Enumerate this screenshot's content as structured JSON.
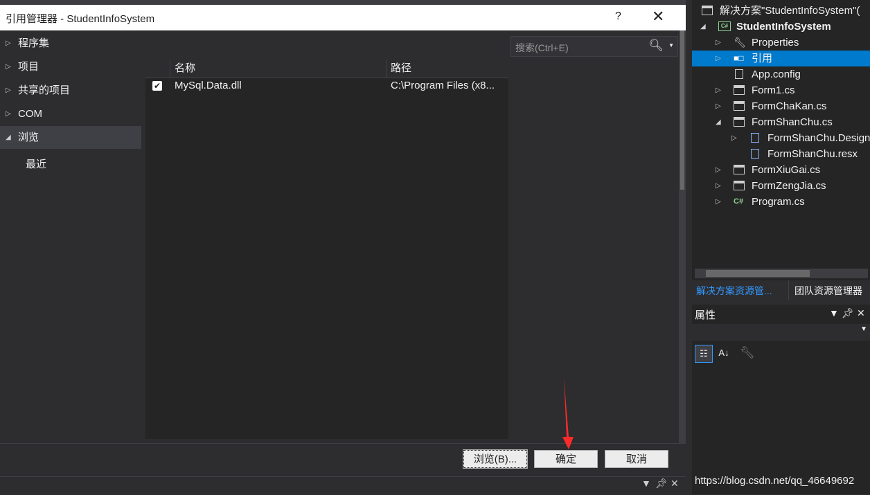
{
  "dialog": {
    "title": "引用管理器 - StudentInfoSystem",
    "help_label": "?",
    "close_label": "✕",
    "nav_items": [
      {
        "label": "程序集",
        "arrow": "▷"
      },
      {
        "label": "项目",
        "arrow": "▷"
      },
      {
        "label": "共享的项目",
        "arrow": "▷"
      },
      {
        "label": "COM",
        "arrow": "▷"
      },
      {
        "label": "浏览",
        "arrow": "◢",
        "selected": true
      },
      {
        "label": "最近",
        "arrow": ""
      }
    ],
    "search": {
      "placeholder": "搜索(Ctrl+E)",
      "icon": "search-icon"
    },
    "grid": {
      "columns": [
        "名称",
        "路径"
      ],
      "rows": [
        {
          "checked": true,
          "name": "MySql.Data.dll",
          "path": "C:\\Program Files (x8..."
        }
      ]
    },
    "buttons": {
      "browse": "浏览(B)...",
      "ok": "确定",
      "cancel": "取消"
    },
    "annotation_color": "#ff2a2a"
  },
  "solution_explorer": {
    "items": [
      {
        "label": "解决方案\"StudentInfoSystem\"(",
        "icon": "solution-icon",
        "tri": ""
      },
      {
        "label": "StudentInfoSystem",
        "icon": "csharp-project-icon",
        "tri": "◢",
        "bold": true
      },
      {
        "label": "Properties",
        "icon": "wrench-icon",
        "tri": "▷"
      },
      {
        "label": "引用",
        "icon": "references-icon",
        "tri": "▷",
        "selected": true
      },
      {
        "label": "App.config",
        "icon": "config-file-icon",
        "tri": ""
      },
      {
        "label": "Form1.cs",
        "icon": "form-icon",
        "tri": "▷"
      },
      {
        "label": "FormChaKan.cs",
        "icon": "form-icon",
        "tri": "▷"
      },
      {
        "label": "FormShanChu.cs",
        "icon": "form-icon",
        "tri": "◢"
      },
      {
        "label": "FormShanChu.Designer.cs",
        "icon": "designer-file-icon",
        "tri": "▷"
      },
      {
        "label": "FormShanChu.resx",
        "icon": "resx-file-icon",
        "tri": ""
      },
      {
        "label": "FormXiuGai.cs",
        "icon": "form-icon",
        "tri": "▷"
      },
      {
        "label": "FormZengJia.cs",
        "icon": "form-icon",
        "tri": "▷"
      },
      {
        "label": "Program.cs",
        "icon": "csharp-file-icon",
        "tri": "▷"
      }
    ],
    "tabs": [
      "解决方案资源管...",
      "团队资源管理器"
    ]
  },
  "properties": {
    "title": "属性",
    "toolbar": [
      "categorized-icon",
      "alphabetical-icon",
      "property-pages-icon"
    ]
  },
  "watermark": "https://blog.csdn.net/qq_46649692"
}
